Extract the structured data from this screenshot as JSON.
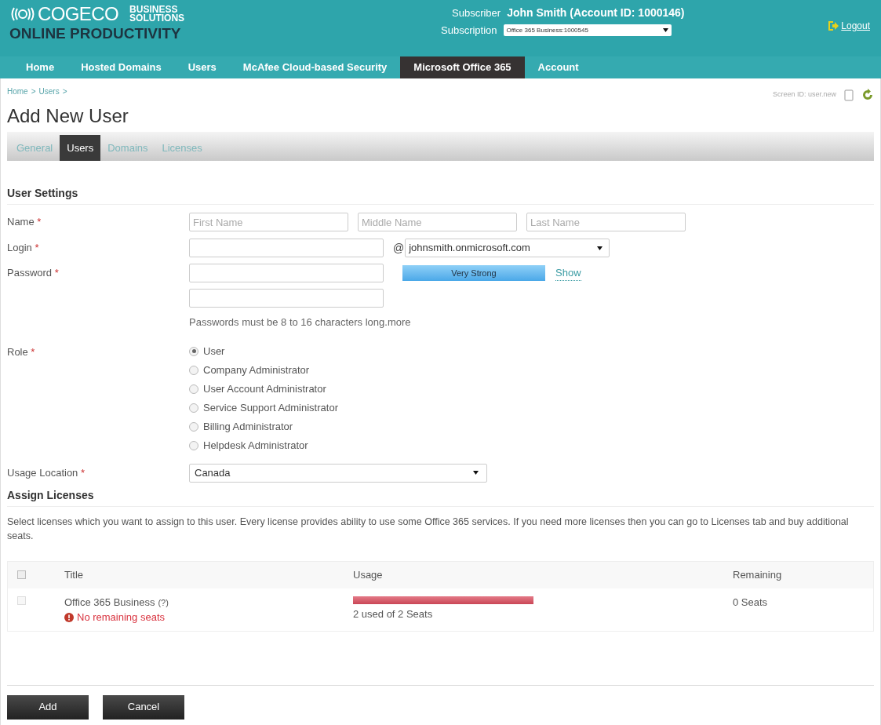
{
  "header": {
    "logo_text": "COGECO",
    "logo_sub": [
      "BUSINESS",
      "SOLUTIONS"
    ],
    "product": "ONLINE PRODUCTIVITY",
    "subscriber_label": "Subscriber",
    "subscriber": "John Smith (Account ID: 1000146)",
    "subscription_label": "Subscription",
    "subscription": "Office 365 Business:1000545",
    "logout": "Logout"
  },
  "nav": [
    {
      "label": "Home",
      "selected": false
    },
    {
      "label": "Hosted Domains",
      "selected": false
    },
    {
      "label": "Users",
      "selected": false
    },
    {
      "label": "McAfee Cloud-based Security",
      "selected": false
    },
    {
      "label": "Microsoft Office 365",
      "selected": true
    },
    {
      "label": "Account",
      "selected": false
    }
  ],
  "breadcrumb": [
    "Home",
    "Users"
  ],
  "breadcrumb_separator": ">",
  "required_mark": "*",
  "screen_id": "Screen ID: user.new",
  "title": "Add New User",
  "tabs": [
    {
      "label": "General",
      "selected": false
    },
    {
      "label": "Users",
      "selected": true
    },
    {
      "label": "Domains",
      "selected": false
    },
    {
      "label": "Licenses",
      "selected": false
    }
  ],
  "user_settings": {
    "heading": "User Settings",
    "name": {
      "label": "Name",
      "placeholders": [
        "First Name",
        "Middle Name",
        "Last Name"
      ]
    },
    "login": {
      "label": "Login",
      "at": "@",
      "domain": "johnsmith.onmicrosoft.com"
    },
    "password": {
      "label": "Password",
      "strength": "Very Strong",
      "level": 1,
      "show": "Show",
      "hint": "Passwords must be 8 to 16 characters long.",
      "more": "more"
    },
    "role": {
      "label": "Role",
      "options": [
        {
          "label": "User",
          "selected": true
        },
        {
          "label": "Company Administrator",
          "selected": false
        },
        {
          "label": "User Account Administrator",
          "selected": false
        },
        {
          "label": "Service Support Administrator",
          "selected": false
        },
        {
          "label": "Billing Administrator",
          "selected": false
        },
        {
          "label": "Helpdesk Administrator",
          "selected": false
        }
      ]
    },
    "usage_location": {
      "label": "Usage Location",
      "value": "Canada"
    }
  },
  "licenses": {
    "heading": "Assign Licenses",
    "description": "Select licenses which you want to assign to this user. Every license provides ability to use some Office 365 services. If you need more licenses then you can go to Licenses tab and buy additional seats.",
    "columns": [
      "Title",
      "Usage",
      "Remaining"
    ],
    "all_checked": false,
    "rows": [
      {
        "title": "Office 365 Business",
        "help": "(?)",
        "warning": "No remaining seats",
        "level": 1,
        "usage": "2 used of 2 Seats",
        "remaining": "0 Seats",
        "checked": false,
        "disabled": true
      }
    ]
  },
  "buttons": [
    "Add",
    "Cancel"
  ]
}
